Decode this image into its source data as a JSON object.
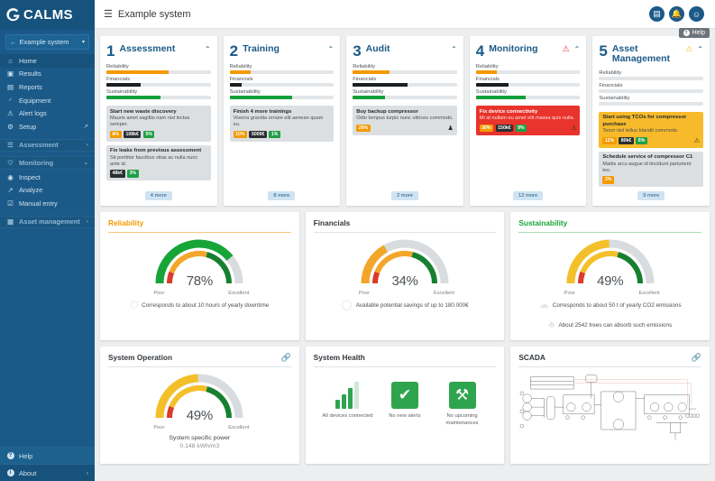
{
  "brand": {
    "name": "CALMS",
    "logo_icon": "calms-logo-icon"
  },
  "sidebar": {
    "system_selector": {
      "label": "Example system",
      "back_icon": "arrow-left-icon",
      "caret_icon": "caret-down-icon"
    },
    "items": [
      {
        "label": "Home",
        "icon": "home-icon",
        "glyph": "⌂",
        "active": true
      },
      {
        "label": "Results",
        "icon": "results-icon",
        "glyph": "▣",
        "active": false
      },
      {
        "label": "Reports",
        "icon": "reports-icon",
        "glyph": "☰",
        "active": false
      },
      {
        "label": "Equipment",
        "icon": "wrench-icon",
        "glyph": "⚒",
        "active": false
      },
      {
        "label": "Alert logs",
        "icon": "warning-triangle-icon",
        "glyph": "⚠",
        "active": false
      },
      {
        "label": "Setup",
        "icon": "gear-icon",
        "glyph": "⚙",
        "active": false,
        "external_icon": "external-link-icon"
      }
    ],
    "sections": [
      {
        "label": "Assessment",
        "icon": "clipboard-icon",
        "glyph": "☰",
        "chevron": "‹"
      },
      {
        "label": "Monitoring",
        "icon": "monitoring-icon",
        "glyph": "♡",
        "chevron": "⌄"
      },
      {
        "label": "Asset management",
        "icon": "asset-icon",
        "glyph": "▦",
        "chevron": "‹"
      }
    ],
    "monitoring_children": [
      {
        "label": "Inspect",
        "icon": "eye-icon",
        "glyph": "◉"
      },
      {
        "label": "Analyze",
        "icon": "chart-icon",
        "glyph": "↗"
      },
      {
        "label": "Manual entry",
        "icon": "manual-entry-icon",
        "glyph": "☑"
      }
    ],
    "bottom": [
      {
        "label": "Help",
        "icon": "help-circle-icon",
        "glyph": "?"
      },
      {
        "label": "About",
        "icon": "info-circle-icon",
        "glyph": "i",
        "chevron": "‹"
      }
    ]
  },
  "topbar": {
    "menu_icon": "hamburger-menu-icon",
    "title": "Example system",
    "actions": [
      {
        "name": "calculator-button",
        "icon": "calculator-icon",
        "glyph": "▤"
      },
      {
        "name": "notifications-button",
        "icon": "bell-icon",
        "glyph": "⚑"
      },
      {
        "name": "account-button",
        "icon": "user-icon",
        "glyph": "☺"
      }
    ],
    "help_chip": {
      "label": "Help",
      "icon": "help-circle-icon"
    }
  },
  "stages": [
    {
      "number": "1",
      "name": "Assessment",
      "chevron": "⌃",
      "warning": null,
      "bars": [
        {
          "label": "Reliability",
          "value": 60,
          "color": "#f49a00"
        },
        {
          "label": "Financials",
          "value": 33,
          "color": "#1c1f21"
        },
        {
          "label": "Sustainability",
          "value": 52,
          "color": "#13a038"
        }
      ],
      "tasks": [
        {
          "title": "Start new waste discovery",
          "desc": "Mauris amet sagittis nam nisl lectus semper.",
          "style": "grey",
          "badges": [
            {
              "text": "8%",
              "color": "#f49a00"
            },
            {
              "text": "108k€",
              "color": "#2b2f31"
            },
            {
              "text": "5%",
              "color": "#1ea046"
            }
          ],
          "icon": null
        },
        {
          "title": "Fix leaks from previous assessment",
          "desc": "Sit porttitor faucibus vitae ac nulla nunc ante id.",
          "style": "grey",
          "badges": [
            {
              "text": "48k€",
              "color": "#2b2f31"
            },
            {
              "text": "3%",
              "color": "#1ea046"
            }
          ],
          "icon": null
        }
      ],
      "more": "4 more"
    },
    {
      "number": "2",
      "name": "Training",
      "chevron": "⌃",
      "warning": null,
      "bars": [
        {
          "label": "Reliability",
          "value": 20,
          "color": "#f49a00"
        },
        {
          "label": "Financials",
          "value": 12,
          "color": "#1c1f21"
        },
        {
          "label": "Sustainability",
          "value": 60,
          "color": "#13a038"
        }
      ],
      "tasks": [
        {
          "title": "Finish 4 more trainings",
          "desc": "Viverra gravida ornare elit aenean quam eu.",
          "style": "grey",
          "badges": [
            {
              "text": "10%",
              "color": "#f49a00"
            },
            {
              "text": "5000€",
              "color": "#2b2f31"
            },
            {
              "text": "1%",
              "color": "#1ea046"
            }
          ],
          "icon": null
        }
      ],
      "more": "8 more"
    },
    {
      "number": "3",
      "name": "Audit",
      "chevron": "⌃",
      "warning": null,
      "bars": [
        {
          "label": "Reliability",
          "value": 35,
          "color": "#f49a00"
        },
        {
          "label": "Financials",
          "value": 53,
          "color": "#1c1f21"
        },
        {
          "label": "Sustainability",
          "value": 31,
          "color": "#13a038"
        }
      ],
      "tasks": [
        {
          "title": "Buy backup compressor",
          "desc": "Odio tempus turpis nunc ultrices commodo.",
          "style": "grey",
          "badges": [
            {
              "text": "20%",
              "color": "#f49a00"
            }
          ],
          "icon": "person-icon"
        }
      ],
      "more": "2 more"
    },
    {
      "number": "4",
      "name": "Monitoring",
      "chevron": "⌃",
      "warning": "red",
      "bars": [
        {
          "label": "Reliability",
          "value": 20,
          "color": "#f49a00"
        },
        {
          "label": "Financials",
          "value": 31,
          "color": "#1c1f21"
        },
        {
          "label": "Sustainability",
          "value": 48,
          "color": "#13a038"
        }
      ],
      "tasks": [
        {
          "title": "Fix device connectivity",
          "desc": "Mi at nullam eu amet elit massa quis nulla.",
          "style": "red",
          "badges": [
            {
              "text": "30%",
              "color": "#f49a00"
            },
            {
              "text": "150k€",
              "color": "#2b2f31"
            },
            {
              "text": "9%",
              "color": "#1ea046"
            }
          ],
          "icon": "warning-triangle-icon"
        }
      ],
      "more": "12 more"
    },
    {
      "number": "5",
      "name": "Asset Management",
      "chevron": "⌃",
      "warning": "orange",
      "bars": [
        {
          "label": "Reliability",
          "value": 0,
          "color": "#f49a00"
        },
        {
          "label": "Financials",
          "value": 0,
          "color": "#1c1f21"
        },
        {
          "label": "Sustainability",
          "value": 0,
          "color": "#13a038"
        }
      ],
      "tasks": [
        {
          "title": "Start using TCOs for compressor purchase",
          "desc": "Tenor nisl tellus blandit commodo.",
          "style": "yellow",
          "badges": [
            {
              "text": "12%",
              "color": "#f49a00"
            },
            {
              "text": "80k€",
              "color": "#2b2f31"
            },
            {
              "text": "6%",
              "color": "#1ea046"
            }
          ],
          "icon": "warning-triangle-icon"
        },
        {
          "title": "Schedule service of compressor C1",
          "desc": "Mattis arcu augue id tincidunt parturient leo.",
          "style": "grey",
          "badges": [
            {
              "text": "3%",
              "color": "#f49a00"
            }
          ],
          "icon": null
        }
      ],
      "more": "9 more"
    }
  ],
  "gauges": [
    {
      "title": "Reliability",
      "title_color": "#f49a00",
      "rule_color": "#f7c97a",
      "value_label": "78%",
      "poor": "Poor",
      "excellent": "Excellent",
      "outer_pct": 78,
      "outer_color": "#17a538",
      "inner_pct": 58,
      "inner_color": "#f4a62a",
      "notes": [
        {
          "text": "Corresponds to about 10 hours of yearly downtime",
          "icon": "power-icon",
          "glyph": "⏻"
        }
      ]
    },
    {
      "title": "Financials",
      "title_color": "#33383d",
      "rule_color": "#dfe3e6",
      "value_label": "34%",
      "poor": "Poor",
      "excellent": "Excellent",
      "outer_pct": 34,
      "outer_color": "#f4a62a",
      "inner_pct": 58,
      "inner_color": "#f4a62a",
      "notes": [
        {
          "text": "Available potential savings of up to 180.000€",
          "icon": "toggle-icon",
          "glyph": "◯"
        }
      ]
    },
    {
      "title": "Sustainability",
      "title_color": "#17a538",
      "rule_color": "#a9dcb7",
      "value_label": "49%",
      "poor": "Poor",
      "excellent": "Excellent",
      "outer_pct": 49,
      "outer_color": "#f4c02a",
      "inner_pct": 58,
      "inner_color": "#f4c02a",
      "notes": [
        {
          "text": "Corresponds to about 50 t of yearly CO2 emissions",
          "icon": "cloud-icon",
          "glyph": "☁"
        },
        {
          "text": "About 2542 trees can absorb such emissions",
          "icon": "tree-icon",
          "glyph": "♣"
        }
      ]
    }
  ],
  "system_operation": {
    "title": "System Operation",
    "link_icon": "link-icon",
    "value_label": "49%",
    "poor": "Poor",
    "excellent": "Excellent",
    "outer_pct": 49,
    "outer_color": "#f4c02a",
    "inner_pct": 58,
    "inner_color": "#f4c02a",
    "caption_line1": "System specific power",
    "caption_line2": "0.148 kWh/m3"
  },
  "system_health": {
    "title": "System Health",
    "items": [
      {
        "icon": "signal-bars-icon",
        "label": "All devices connected"
      },
      {
        "icon": "check-mark-icon",
        "glyph": "✔",
        "label": "No new alerts"
      },
      {
        "icon": "tools-icon",
        "glyph": "⚒",
        "label": "No upcoming maintenances"
      }
    ]
  },
  "scada": {
    "title": "SCADA",
    "link_icon": "link-icon",
    "diagram_icon": "scada-schematic-diagram"
  },
  "colors": {
    "sidebar_bg": "#1b5a88",
    "sidebar_dark": "#17527c",
    "accent_blue": "#1b5a88",
    "orange": "#f49a00",
    "green": "#17a538",
    "red": "#e8342c",
    "yellow": "#f7ba2a",
    "page_bg": "#eceef0"
  }
}
